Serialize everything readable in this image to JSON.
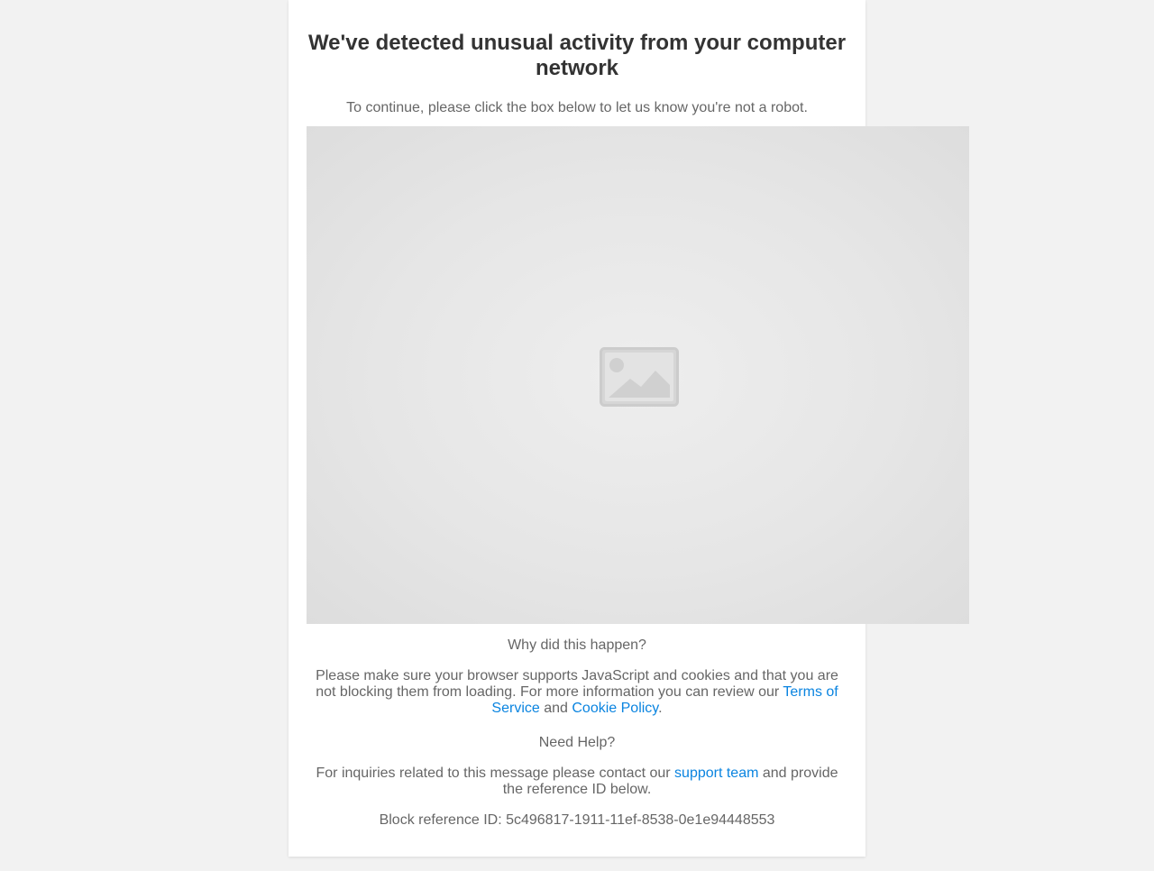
{
  "heading": "We've detected unusual activity from your computer network",
  "subtitle": "To continue, please click the box below to let us know you're not a robot.",
  "captcha": {
    "icon": "image-placeholder-icon"
  },
  "why": {
    "title": "Why did this happen?",
    "text_before": "Please make sure your browser supports JavaScript and cookies and that you are not blocking them from loading. For more information you can review our ",
    "terms_link": "Terms of Service",
    "and_text": " and ",
    "cookie_link": "Cookie Policy",
    "period": "."
  },
  "help": {
    "title": "Need Help?",
    "text_before": "For inquiries related to this message please contact our ",
    "support_link": "support team",
    "text_after": " and provide the reference ID below."
  },
  "reference": "Block reference ID: 5c496817-1911-11ef-8538-0e1e94448553",
  "colors": {
    "background": "#f2f2f2",
    "card": "#ffffff",
    "heading": "#333333",
    "text": "#666666",
    "link": "#0a84e0"
  }
}
